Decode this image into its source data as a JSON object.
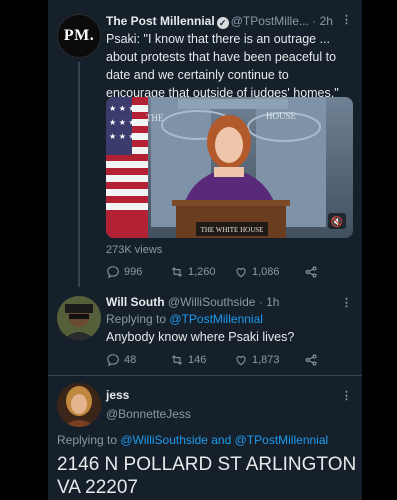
{
  "colors": {
    "background": "#15202b",
    "link": "#1d9bf0",
    "muted": "#8b98a5",
    "text": "#e7e9ea",
    "divider": "#38444d"
  },
  "tweet1": {
    "avatar_text": "PM.",
    "name": "The Post Millennial",
    "handle": "@TPostMille...",
    "time": "· 2h",
    "text": "Psaki: \"I know that there is an outrage ... about protests that have been peaceful to date and we certainly continue to encourage that outside of judges' homes.\"",
    "media": {
      "podium_label": "THE WHITE HOUSE",
      "backdrop_label": "THE WHITE HOUSE",
      "icon": "mute-icon"
    },
    "views": "273K views",
    "actions": {
      "replies": "996",
      "retweets": "1,260",
      "likes": "1,086"
    }
  },
  "tweet2": {
    "name": "Will South",
    "handle": "@WilliSouthside",
    "time": "· 1h",
    "replying_prefix": "Replying to ",
    "replying_to": "@TPostMillennial",
    "text": "Anybody know where Psaki lives?",
    "actions": {
      "replies": "48",
      "retweets": "146",
      "likes": "1,873"
    }
  },
  "tweet3": {
    "name": "jess",
    "handle": "@BonnetteJess",
    "replying_prefix": "Replying to ",
    "replying_to_1": "@WilliSouthside",
    "replying_and": " and ",
    "replying_to_2": "@TPostMillennial",
    "text": "2146 N POLLARD ST ARLINGTON VA 22207"
  }
}
